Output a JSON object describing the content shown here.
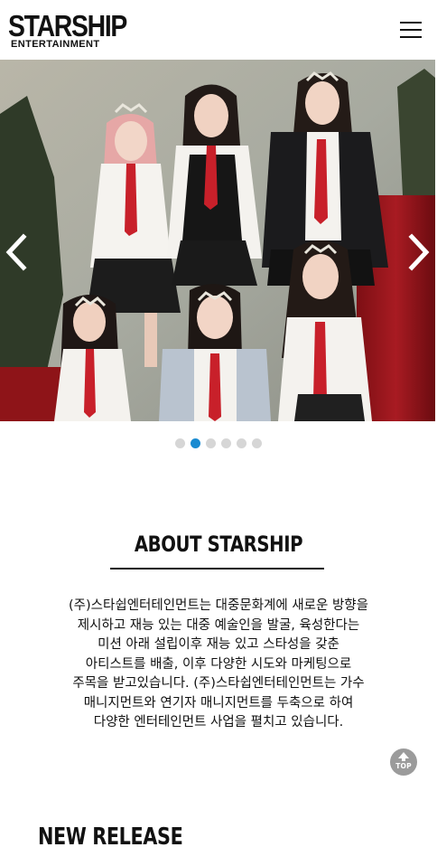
{
  "header": {
    "logo_main": "STARSHIP",
    "logo_sub": "ENTERTAINMENT",
    "menu_icon": "hamburger-menu-icon"
  },
  "slider": {
    "prev_icon": "chevron-left-icon",
    "next_icon": "chevron-right-icon",
    "slide_count": 6,
    "active_index": 1,
    "accent_color": "#1a8bd1",
    "inactive_color": "#d6d6d6"
  },
  "about": {
    "title": "ABOUT STARSHIP",
    "body": "(주)스타쉽엔터테인먼트는 대중문화계에 새로운 방향을 제시하고 재능 있는 대중 예술인을 발굴, 육성한다는 미션 아래 설립이후 재능 있고 스타성을 갖춘 아티스트를 배출, 이후 다양한 시도와 마케팅으로 주목을 받고있습니다. (주)스타쉽엔터테인먼트는 가수 매니지먼트와 연기자 매니지먼트를 두축으로 하여 다양한 엔터테인먼트 사업을 펼치고 있습니다."
  },
  "top_button": {
    "label": "TOP",
    "icon": "arrow-up-icon"
  },
  "new_release": {
    "title": "NEW RELEASE"
  }
}
